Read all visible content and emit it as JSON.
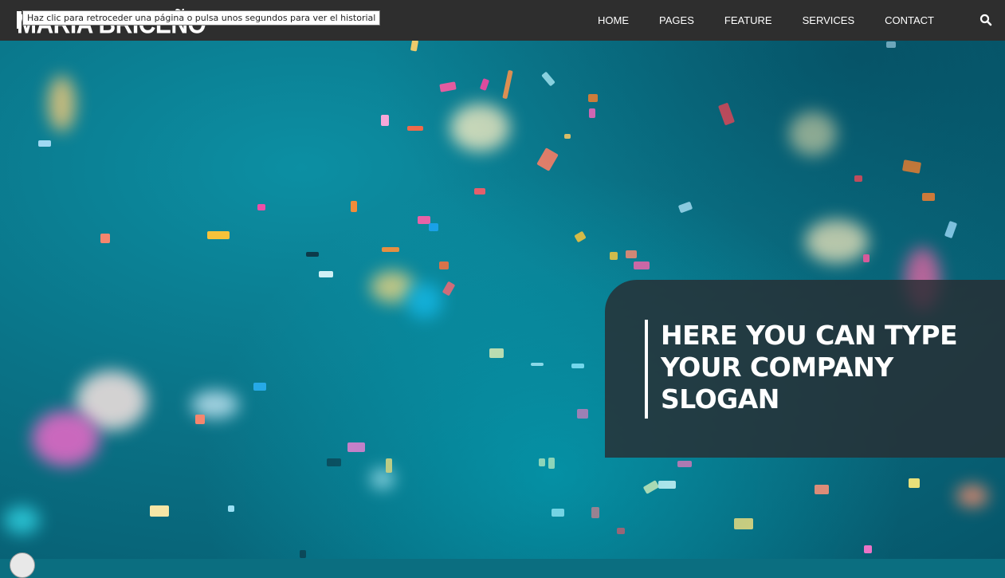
{
  "brand": {
    "name": "MARIA BRICEÑO"
  },
  "tooltip": {
    "text": "Haz clic para retroceder una página o pulsa unos segundos para ver el historial"
  },
  "nav": {
    "items": [
      {
        "label": "HOME"
      },
      {
        "label": "PAGES"
      },
      {
        "label": "FEATURE"
      },
      {
        "label": "SERVICES"
      },
      {
        "label": "CONTACT"
      }
    ],
    "search_icon": "search-icon"
  },
  "hero": {
    "slogan": "HERE YOU CAN TYPE YOUR COMPANY SLOGAN"
  },
  "colors": {
    "navbar": "#2e2e2e",
    "background": "#0a7387",
    "slogan_box": "#2d3135"
  }
}
